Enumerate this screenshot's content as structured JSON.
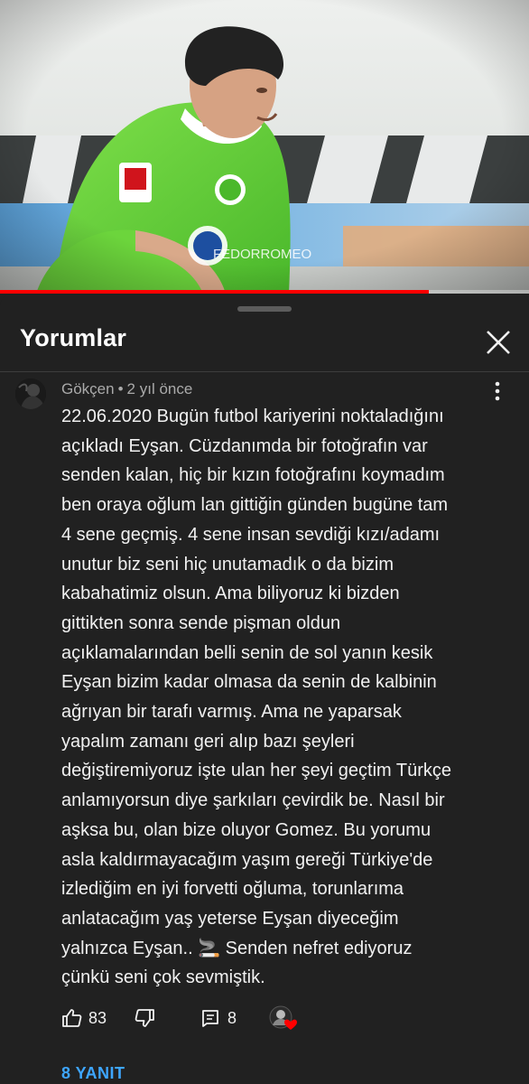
{
  "video": {
    "watermark": "FEDORROMEO",
    "progress_fraction": 0.81,
    "progress_color": "#ff0000"
  },
  "comments_panel": {
    "title": "Yorumlar",
    "close_icon": "close-icon"
  },
  "comment": {
    "author": "Gökçen",
    "separator": "•",
    "time": "2 yıl önce",
    "menu_icon": "more-vert-icon",
    "lines": [
      "22.06.2020 Bugün futbol kariyerini noktaladığını",
      "açıkladı Eyşan. Cüzdanımda bir fotoğrafın var",
      "senden kalan, hiç bir kızın fotoğrafını koymadım",
      "ben oraya oğlum lan gittiğin günden bugüne tam",
      "4 sene geçmiş. 4 sene insan sevdiği kızı/adamı",
      "unutur biz seni hiç unutamadık o da bizim",
      "kabahatimiz olsun. Ama biliyoruz ki bizden",
      "gittikten sonra sende pişman oldun",
      "açıklamalarından belli senin de sol yanın kesik",
      "Eyşan bizim kadar olmasa da senin de kalbinin",
      "ağrıyan bir tarafı varmış. Ama ne yaparsak",
      "yapalım zamanı geri alıp bazı şeyleri",
      "değiştiremiyoruz işte ulan her şeyi geçtim Türkçe",
      "anlamıyorsun diye şarkıları çevirdik be. Nasıl bir",
      "aşksa bu, olan bize oluyor Gomez. Bu yorumu",
      "asla kaldırmayacağım yaşım gereği Türkiye'de",
      "izlediğim en iyi forvetti oğluma, torunlarıma",
      "anlatacağım yaş yeterse Eyşan diyeceğim",
      "yalnızca Eyşan.. 🚬 Senden nefret ediyoruz",
      "çünkü seni çok sevmiştik."
    ],
    "likes": "83",
    "replies_count": "8",
    "replies_label": "8 YANIT",
    "accent_color": "#3ea6ff",
    "heart_color": "#ff0000"
  }
}
